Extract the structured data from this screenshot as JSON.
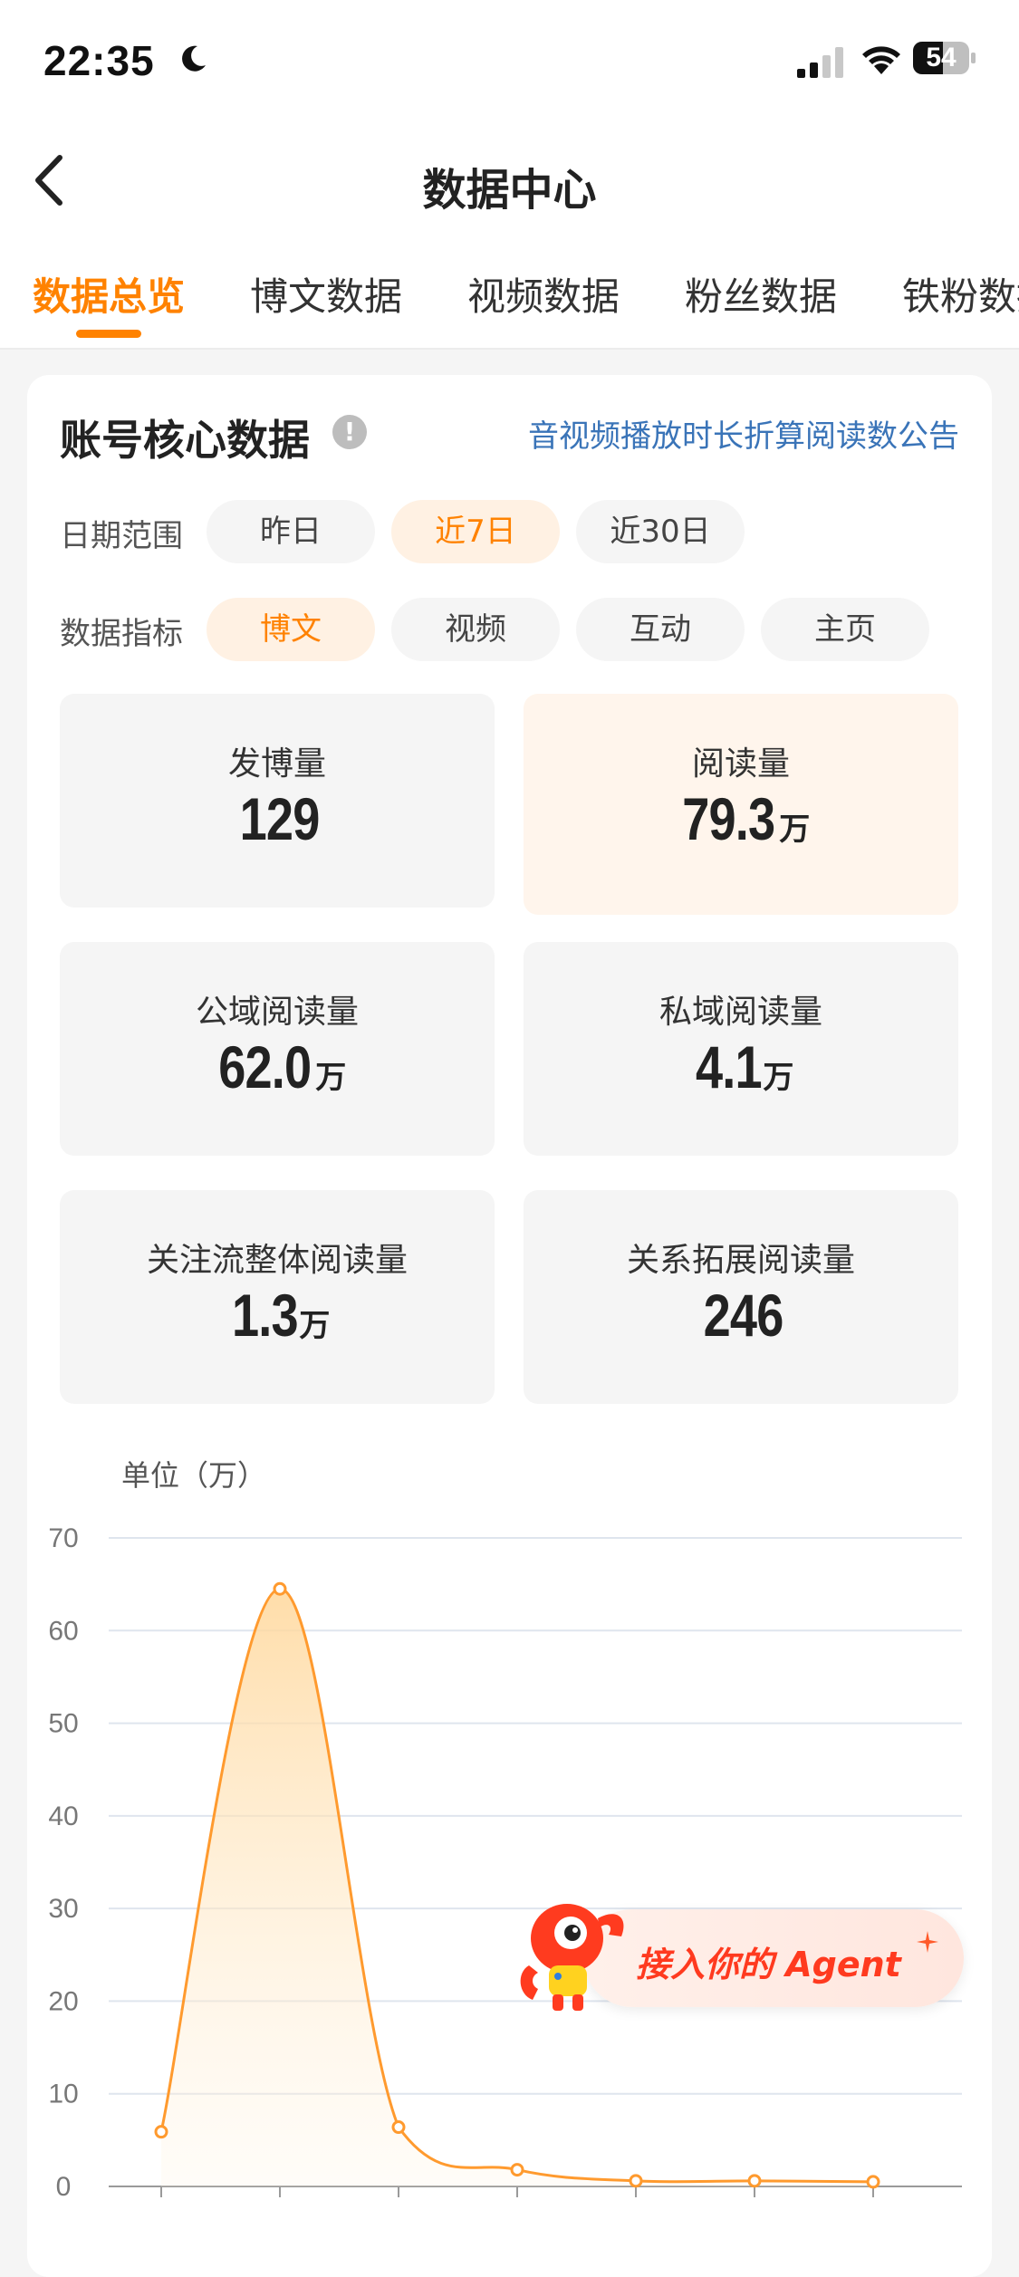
{
  "status_bar": {
    "time": "22:35",
    "battery": "54",
    "battery_level": 0.54
  },
  "nav": {
    "title": "数据中心"
  },
  "tabs": [
    {
      "label": "数据总览",
      "active": true
    },
    {
      "label": "博文数据",
      "active": false
    },
    {
      "label": "视频数据",
      "active": false
    },
    {
      "label": "粉丝数据",
      "active": false
    },
    {
      "label": "铁粉数据",
      "active": false
    }
  ],
  "card": {
    "title": "账号核心数据",
    "info_icon": "!",
    "notice_link": "音视频播放时长折算阅读数公告"
  },
  "date_range": {
    "label": "日期范围",
    "options": [
      {
        "label": "昨日",
        "active": false
      },
      {
        "label": "近7日",
        "active": true
      },
      {
        "label": "近30日",
        "active": false
      }
    ]
  },
  "metric_type": {
    "label": "数据指标",
    "options": [
      {
        "label": "博文",
        "active": true
      },
      {
        "label": "视频",
        "active": false
      },
      {
        "label": "互动",
        "active": false
      },
      {
        "label": "主页",
        "active": false
      }
    ]
  },
  "metrics": [
    {
      "label": "发博量",
      "value": "129",
      "unit": "",
      "active": false
    },
    {
      "label": "阅读量",
      "value": "79.3",
      "unit": "万",
      "active": true
    },
    {
      "label": "公域阅读量",
      "value": "62.0",
      "unit": "万",
      "active": false
    },
    {
      "label": "私域阅读量",
      "value": "4.1",
      "unit": "万",
      "active": false
    },
    {
      "label": "关注流整体阅读量",
      "value": "1.3",
      "unit": "万",
      "active": false
    },
    {
      "label": "关系拓展阅读量",
      "value": "246",
      "unit": "",
      "active": false
    }
  ],
  "chart_data": {
    "type": "area",
    "ylabel": "单位（万）",
    "ylim": [
      0,
      70
    ],
    "yticks": [
      "0",
      "10",
      "20",
      "30",
      "40",
      "50",
      "60",
      "70"
    ],
    "series": [
      {
        "values": [
          5.9,
          64.5,
          6.4,
          1.8,
          0.6,
          0.6,
          0.5
        ]
      }
    ],
    "grid": true,
    "line_color": "#ff9a2e"
  },
  "agent_button": {
    "label": "接入你的 Agent"
  },
  "colors": {
    "accent": "#ff8200",
    "link": "#3a74b8"
  }
}
